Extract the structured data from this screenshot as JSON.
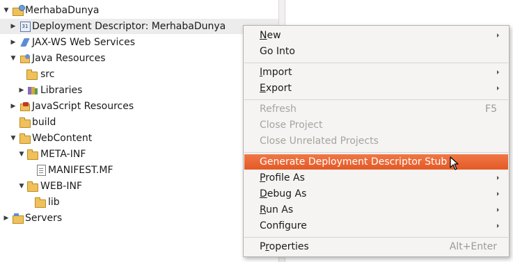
{
  "explorer": {
    "items": [
      {
        "label": "MerhabaDunya",
        "icon": "project-icon",
        "twisty": "expanded"
      },
      {
        "label": "Deployment Descriptor: MerhabaDunya",
        "icon": "deployment-descriptor-icon",
        "twisty": "collapsed"
      },
      {
        "label": "JAX-WS Web Services",
        "icon": "jax-ws-icon",
        "twisty": "collapsed"
      },
      {
        "label": "Java Resources",
        "icon": "java-resources-icon",
        "twisty": "expanded"
      },
      {
        "label": "src",
        "icon": "package-folder-icon",
        "twisty": "none"
      },
      {
        "label": "Libraries",
        "icon": "libraries-icon",
        "twisty": "collapsed"
      },
      {
        "label": "JavaScript Resources",
        "icon": "javascript-resources-icon",
        "twisty": "collapsed"
      },
      {
        "label": "build",
        "icon": "folder-icon",
        "twisty": "none"
      },
      {
        "label": "WebContent",
        "icon": "folder-icon",
        "twisty": "expanded"
      },
      {
        "label": "META-INF",
        "icon": "folder-icon",
        "twisty": "expanded"
      },
      {
        "label": "MANIFEST.MF",
        "icon": "file-icon",
        "twisty": "none"
      },
      {
        "label": "WEB-INF",
        "icon": "folder-icon",
        "twisty": "expanded"
      },
      {
        "label": "lib",
        "icon": "folder-icon",
        "twisty": "none"
      },
      {
        "label": "Servers",
        "icon": "servers-folder-icon",
        "twisty": "collapsed"
      }
    ]
  },
  "context_menu": {
    "items": [
      {
        "label": "New",
        "mnemonic": "N",
        "rest": "ew",
        "submenu": true
      },
      {
        "label": "Go Into",
        "mnemonic": "",
        "rest": "Go Into"
      },
      {
        "label": "Import",
        "mnemonic": "I",
        "rest": "mport",
        "submenu": true
      },
      {
        "label": "Export",
        "mnemonic": "E",
        "rest": "xport",
        "submenu": true
      },
      {
        "label": "Refresh",
        "shortcut": "F5",
        "disabled": true
      },
      {
        "label": "Close Project",
        "disabled": true
      },
      {
        "label": "Close Unrelated Projects",
        "disabled": true
      },
      {
        "label": "Generate Deployment Descriptor Stub",
        "highlighted": true
      },
      {
        "label": "Profile As",
        "mnemonic": "P",
        "rest": "rofile As",
        "submenu": true
      },
      {
        "label": "Debug As",
        "mnemonic": "D",
        "rest": "ebug As",
        "submenu": true
      },
      {
        "label": "Run As",
        "mnemonic": "R",
        "rest": "un As",
        "submenu": true
      },
      {
        "label": "Configure",
        "submenu": true
      },
      {
        "label": "Properties",
        "mnemonic": "r",
        "shortcut": "Alt+Enter"
      }
    ]
  },
  "colors": {
    "highlight": "#e8602e",
    "menu_bg": "#f5f4f2",
    "disabled_text": "#a6a49f"
  }
}
